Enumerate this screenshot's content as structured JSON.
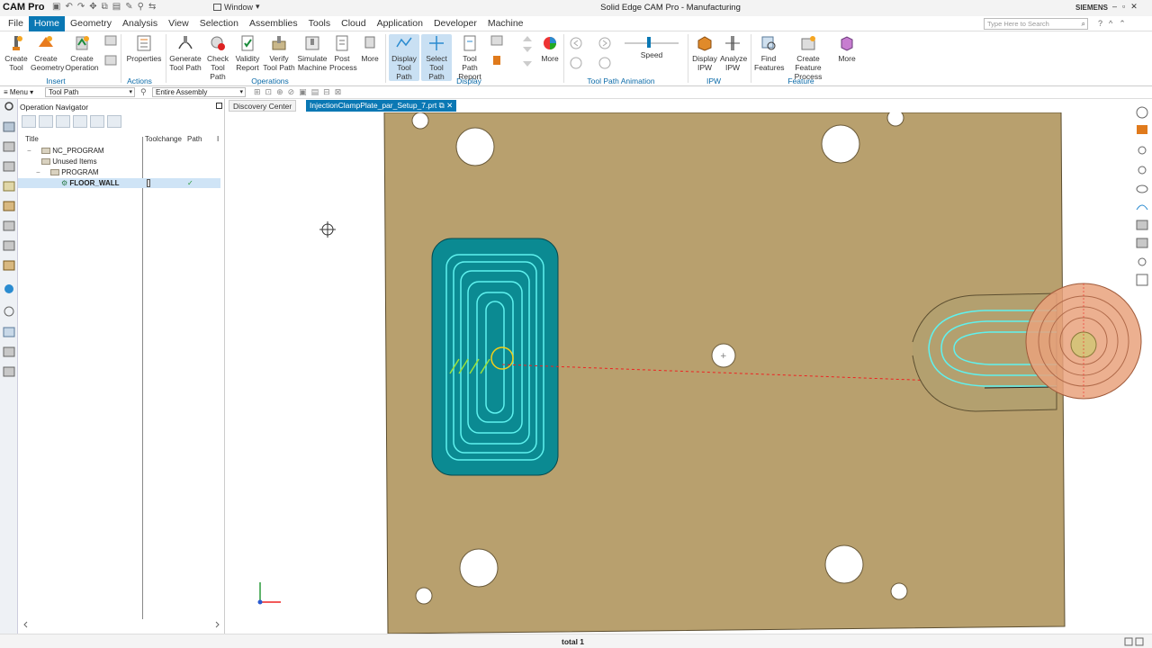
{
  "app": {
    "brand": "CAM Pro",
    "window_label": "Window",
    "title": "Solid Edge CAM Pro - Manufacturing",
    "vendor": "SIEMENS",
    "search_placeholder": "Type Here to Search"
  },
  "menu": [
    "File",
    "Home",
    "Geometry",
    "Analysis",
    "View",
    "Selection",
    "Assemblies",
    "Tools",
    "Cloud",
    "Application",
    "Developer",
    "Machine"
  ],
  "ribbon": {
    "buttons": {
      "create_tool": "Create Tool",
      "create_geometry": "Create Geometry",
      "create_operation": "Create Operation",
      "properties": "Properties",
      "generate_tool_path": "Generate Tool Path",
      "check_tool_path": "Check Tool Path",
      "validity_report": "Validity Report",
      "verify_tool_path": "Verify Tool Path",
      "simulate_machine": "Simulate Machine",
      "post_process": "Post Process",
      "more_ops": "More",
      "display_tool_path": "Display Tool Path",
      "select_tool_path": "Select Tool Path",
      "tool_path_report": "Tool Path Report",
      "more_display": "More",
      "speed": "Speed",
      "display_ipw": "Display IPW",
      "analyze_ipw": "Analyze IPW",
      "find_features": "Find Features",
      "create_feature_process": "Create Feature Process",
      "more_feature": "More"
    },
    "groups": {
      "insert": "Insert",
      "actions": "Actions",
      "operations": "Operations",
      "display": "Display",
      "tool_path_animation": "Tool Path Animation",
      "ipw": "IPW",
      "feature": "Feature"
    },
    "colors": {
      "accent": "#0a78b4",
      "selected": "#c9e0f3"
    }
  },
  "selection_bar": {
    "menu_label": "Menu",
    "filter_value": "Tool Path",
    "scope_value": "Entire Assembly"
  },
  "navigator": {
    "title": "Operation Navigator",
    "columns": [
      "Title",
      "Toolchange",
      "Path"
    ],
    "column_truncated": "I",
    "items": [
      {
        "label": "NC_PROGRAM",
        "level": 0
      },
      {
        "label": "Unused Items",
        "level": 1
      },
      {
        "label": "PROGRAM",
        "level": 1
      },
      {
        "label": "FLOOR_WALL",
        "level": 2,
        "selected": true,
        "path_status": "✓"
      }
    ]
  },
  "tabs": [
    {
      "label": "Discovery Center",
      "active": false
    },
    {
      "label": "InjectionClampPlate_par_Setup_7.prt",
      "active": true
    }
  ],
  "status": {
    "text": "total 1"
  }
}
